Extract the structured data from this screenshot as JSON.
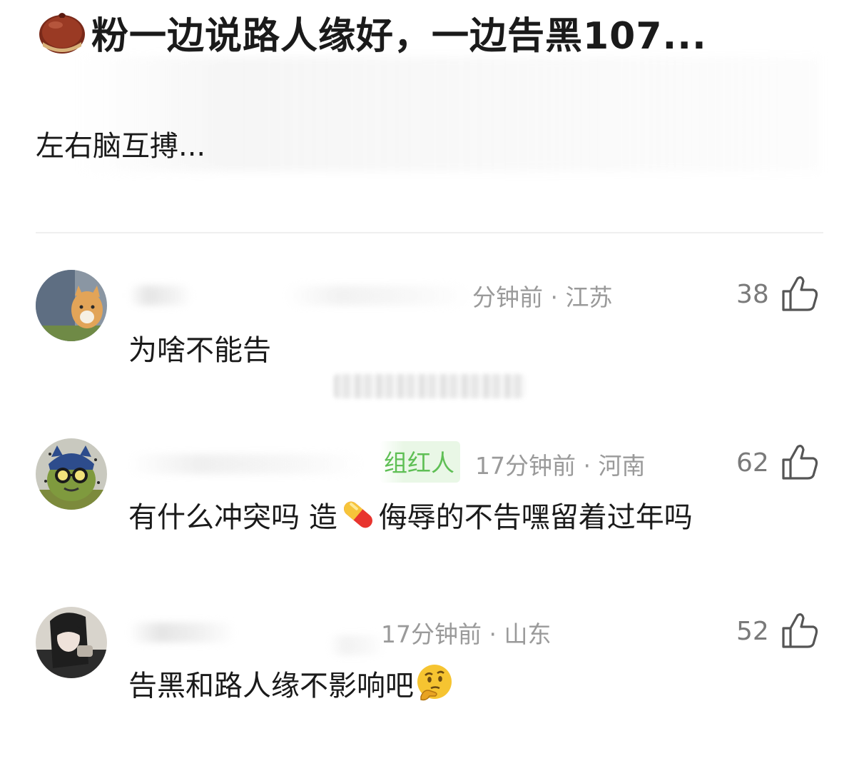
{
  "post": {
    "title": "粉一边说路人缘好，一边告黑107...",
    "title_icon": "chestnut-emoji",
    "body": "左右脑互搏..."
  },
  "comments": [
    {
      "meta": "分钟前 · 江苏",
      "likes": "38",
      "text": "为啥不能告",
      "avatar": "cat-photo-avatar"
    },
    {
      "badge": "组红人",
      "meta": "17分钟前 · 河南",
      "likes": "62",
      "text_before": "有什么冲突吗 造",
      "text_after": "侮辱的不告嘿留着过年吗",
      "avatar": "cartoon-avatar",
      "emoji": "pill-emoji"
    },
    {
      "meta": "17分钟前 · 山东",
      "likes": "52",
      "text": "告黑和路人缘不影响吧",
      "avatar": "girl-photo-avatar",
      "emoji": "thinking-face-emoji"
    }
  ],
  "colors": {
    "text": "#1a1a1a",
    "meta": "#9a9a9a",
    "like": "#7a7a7a",
    "badge": "#5fbf55",
    "divider": "#efefef"
  }
}
